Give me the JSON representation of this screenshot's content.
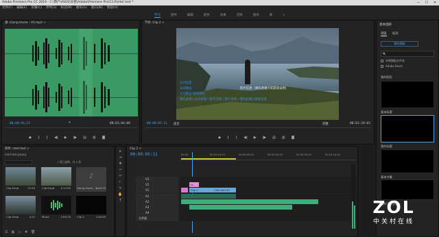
{
  "titlebar": {
    "title": "Adobe Premiere Pro CC 2019 - C:\\用户\\ASUS\\文档\\Adobe\\Premiere Pro\\13.0\\intel test *",
    "min": "—",
    "max": "☐",
    "close": "✕"
  },
  "menu": [
    "文件(F)",
    "编辑(E)",
    "剪辑(C)",
    "序列(S)",
    "标记(M)",
    "图形(G)",
    "窗口(W)",
    "帮助(H)"
  ],
  "workspaces": {
    "items": [
      "学习",
      "组件",
      "编辑",
      "颜色",
      "效果",
      "音频",
      "图形",
      "库"
    ],
    "active": "学习",
    "more": "»"
  },
  "source": {
    "tab": "源: Going Home - V0.mp3",
    "tab_menu": "≡",
    "timecode_in": "00;00;46;13",
    "timecode_dur": "00;01;04;00",
    "ruler_mark": "▼"
  },
  "program": {
    "tab": "节目: Clip 2",
    "tab_menu": "≡",
    "timecode": "00:00:05:11",
    "fit": "适合",
    "quality": "完整",
    "duration": "00:01:20:03",
    "overlay_lines": [
      {
        "text": "公司信息",
        "style": "blue"
      },
      {
        "text": "公司网址",
        "style": "blue"
      },
      {
        "text": "公司网址 制作时间",
        "style": "blue"
      },
      {
        "text": "影片信息（请在此输入标题或说明）",
        "style": "white"
      },
      {
        "text": "请在此输入公司名称 / 影片名称 / 客户名称 / 请在此输入相关信息",
        "style": "blue"
      }
    ]
  },
  "right_panel": {
    "title": "基本图形",
    "tabs": [
      "浏览",
      "编辑"
    ],
    "active_tab": "浏览",
    "button": "我的模板",
    "search_placeholder": "🔍",
    "check_local": "本地模板文件夹",
    "check_adobe": "Adobe Stock",
    "items": [
      "我的图形",
      "基本标题",
      "我的标题",
      "基本字幕",
      "我的下三分之一"
    ]
  },
  "project": {
    "tab": "项目: intel test",
    "tab_menu": "≡",
    "bin_name": "intel test.prproj",
    "count": "1 项已选择，共 9 项",
    "items": [
      {
        "name": "Clip Empt",
        "dur": "12:20"
      },
      {
        "name": "Clip Empt",
        "dur": "4:13:05"
      },
      {
        "name": "Going Home - V...",
        "dur": "1:04:00"
      },
      {
        "name": "Clip Empt",
        "dur": "4:12"
      },
      {
        "name": "Music",
        "dur": "1:05:10"
      },
      {
        "name": "Clip 2",
        "dur": "1:20:03"
      }
    ]
  },
  "tools": [
    "▸",
    "⇥",
    "✥",
    "⇿",
    "✂",
    "⊢",
    "✎",
    "✋",
    "T"
  ],
  "timeline": {
    "tab": "Clip 2",
    "tab_menu": "≡",
    "timecode": "00:00:05:11",
    "ruler": [
      "00:00",
      "00:00:14:23",
      "00:00:29:23",
      "00:00:44:22",
      "00:00:59:22",
      "00:01:14:22"
    ],
    "tracks": [
      "V3",
      "V2",
      "V1",
      "A1",
      "A2",
      "A3",
      "A4"
    ],
    "clip_v2": "fx",
    "clip_v1": "Clip 2",
    "clip_v1b": "Clip Intel 03",
    "master": "主声道"
  },
  "watermark": {
    "brand": "ZOL",
    "tagline": "中关村在线"
  }
}
